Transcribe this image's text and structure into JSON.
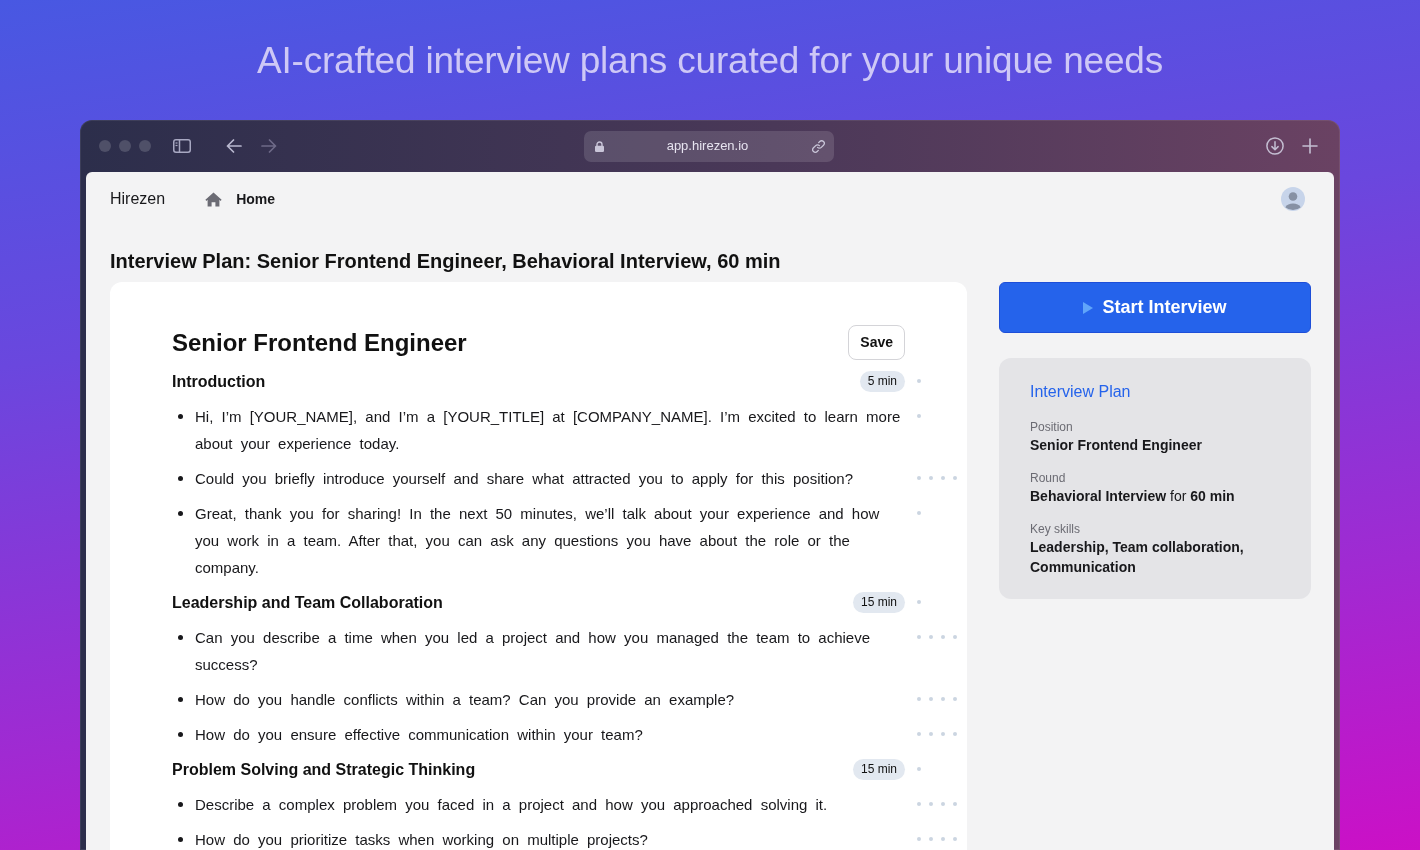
{
  "headline": "AI-crafted interview plans curated for your unique needs",
  "browser": {
    "url": "app.hirezen.io"
  },
  "navbar": {
    "brand": "Hirezen",
    "links": [
      {
        "label": "Home"
      }
    ]
  },
  "page_title": "Interview Plan: Senior Frontend Engineer, Behavioral Interview, 60 min",
  "plan": {
    "title": "Senior Frontend Engineer",
    "save_button": "Save",
    "sections": [
      {
        "title": "Introduction",
        "duration": "5 min",
        "questions": [
          {
            "text": "Hi, I’m [YOUR_NAME], and I’m a [YOUR_TITLE] at [COMPANY_NAME]. I’m excited to learn more about your experience today.",
            "kind": "dot"
          },
          {
            "text": "Could you briefly introduce yourself and share what attracted you to apply for this position?",
            "kind": "dots"
          },
          {
            "text": "Great, thank you for sharing! In the next 50 minutes, we’ll talk about your experience and how you work in a team. After that, you can ask any questions you have about the role or the company.",
            "kind": "dot"
          }
        ]
      },
      {
        "title": "Leadership and Team Collaboration",
        "duration": "15 min",
        "questions": [
          {
            "text": "Can you describe a time when you led a project and how you managed the team to achieve success?",
            "kind": "dots"
          },
          {
            "text": "How do you handle conflicts within a team? Can you provide an example?",
            "kind": "dots"
          },
          {
            "text": "How do you ensure effective communication within your team?",
            "kind": "dots"
          }
        ]
      },
      {
        "title": "Problem Solving and Strategic Thinking",
        "duration": "15 min",
        "questions": [
          {
            "text": "Describe a complex problem you faced in a project and how you approached solving it.",
            "kind": "dots"
          },
          {
            "text": "How do you prioritize tasks when working on multiple projects?",
            "kind": "dots"
          }
        ]
      }
    ]
  },
  "sidebar": {
    "start_button": "Start Interview",
    "summary": {
      "title": "Interview Plan",
      "fields": [
        {
          "label": "Position",
          "value": "Senior Frontend Engineer",
          "kind": "plain"
        },
        {
          "label": "Round",
          "value": "**Behavioral Interview** for **60 min**",
          "kind": "rich"
        },
        {
          "label": "Key skills",
          "value": "Leadership, Team collaboration, Communication",
          "kind": "plain"
        }
      ]
    }
  }
}
